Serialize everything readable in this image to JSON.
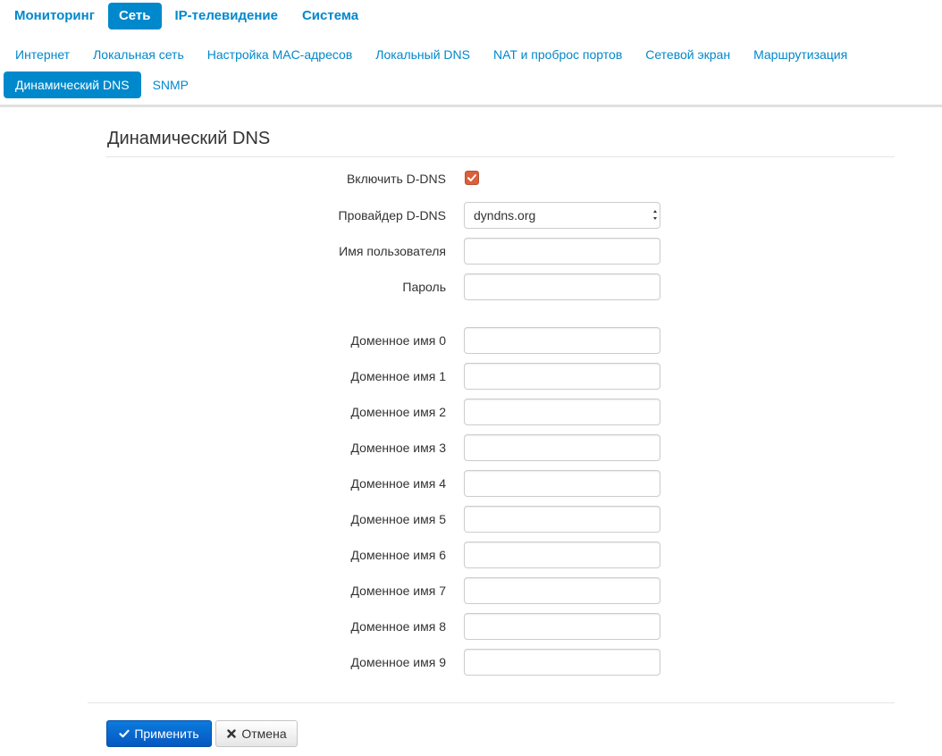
{
  "top_nav": {
    "items": [
      {
        "label": "Мониторинг"
      },
      {
        "label": "Сеть"
      },
      {
        "label": "IP-телевидение"
      },
      {
        "label": "Система"
      }
    ]
  },
  "sub_nav": {
    "row1": [
      {
        "label": "Интернет"
      },
      {
        "label": "Локальная сеть"
      },
      {
        "label": "Настройка MAC-адресов"
      },
      {
        "label": "Локальный DNS"
      },
      {
        "label": "NAT и проброс портов"
      },
      {
        "label": "Сетевой экран"
      },
      {
        "label": "Маршрутизация"
      }
    ],
    "row2": [
      {
        "label": "Динамический DNS"
      },
      {
        "label": "SNMP"
      }
    ]
  },
  "page": {
    "title": "Динамический DNS"
  },
  "form": {
    "enable_label": "Включить D-DNS",
    "enable_checked": true,
    "provider_label": "Провайдер D-DNS",
    "provider_value": "dyndns.org",
    "username_label": "Имя пользователя",
    "username_value": "",
    "password_label": "Пароль",
    "password_value": "",
    "domains": [
      {
        "label": "Доменное имя 0",
        "value": ""
      },
      {
        "label": "Доменное имя 1",
        "value": ""
      },
      {
        "label": "Доменное имя 2",
        "value": ""
      },
      {
        "label": "Доменное имя 3",
        "value": ""
      },
      {
        "label": "Доменное имя 4",
        "value": ""
      },
      {
        "label": "Доменное имя 5",
        "value": ""
      },
      {
        "label": "Доменное имя 6",
        "value": ""
      },
      {
        "label": "Доменное имя 7",
        "value": ""
      },
      {
        "label": "Доменное имя 8",
        "value": ""
      },
      {
        "label": "Доменное имя 9",
        "value": ""
      }
    ]
  },
  "buttons": {
    "apply_label": "Применить",
    "apply_icon": "check-icon",
    "cancel_label": "Отмена",
    "cancel_icon": "close-icon"
  },
  "colors": {
    "accent": "#0088cc",
    "checkbox": "#d9603b",
    "apply_button": "#0a6ed1"
  }
}
